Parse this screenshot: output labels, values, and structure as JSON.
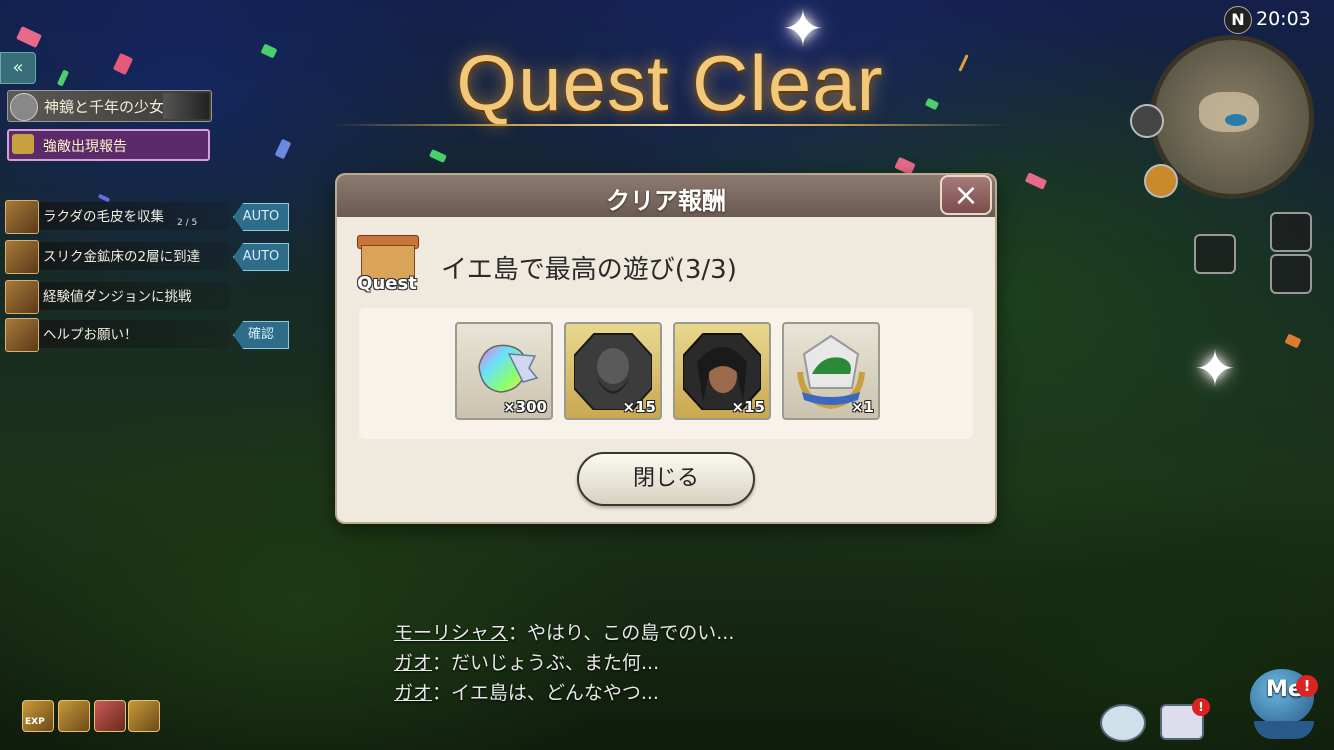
{
  "title": "Quest Clear",
  "event": {
    "banner_text": "神鏡と千年の少女",
    "sub_text": "強敵出現報告"
  },
  "quest_tracker": [
    {
      "label": "ラクダの毛皮を収集",
      "progress": "2 / 5",
      "button": "AUTO"
    },
    {
      "label": "スリク金鉱床の2層に到達",
      "progress": "",
      "button": "AUTO"
    },
    {
      "label": "経験値ダンジョンに挑戦",
      "progress": "",
      "button": ""
    },
    {
      "label": "ヘルプお願い！",
      "progress": "",
      "button": "確認"
    }
  ],
  "dialog": {
    "title": "クリア報酬",
    "close_icon": "×",
    "quest_icon_label": "Quest",
    "quest_name": "イエ島で最高の遊び(3/3)",
    "rewards": [
      {
        "icon": "rainbow-crystal-icon",
        "qty": "×300"
      },
      {
        "icon": "bearded-hero-portrait-icon",
        "qty": "×15"
      },
      {
        "icon": "dark-haired-hero-portrait-icon",
        "qty": "×15"
      },
      {
        "icon": "green-hat-emblem-icon",
        "qty": "×1"
      }
    ],
    "close_button": "閉じる"
  },
  "hud": {
    "clock": "20:03",
    "compass": "N",
    "me_label": "Me"
  },
  "chat": [
    {
      "name": "モーリシャス",
      "text": "：やはり、この島でのい..."
    },
    {
      "name": "ガオ",
      "text": "：だいじょうぶ、また何..."
    },
    {
      "name": "ガオ",
      "text": "：イエ島は、どんなやつ..."
    }
  ],
  "bottom_icons": [
    "exp-icon",
    "pet-icon",
    "boot-icon",
    "crown-icon"
  ],
  "colors": {
    "title_gold": "#f2c87a",
    "dialog_bg": "#efeadd",
    "dialog_header": "#7b6a61",
    "auto_button": "#2f6c8a"
  }
}
